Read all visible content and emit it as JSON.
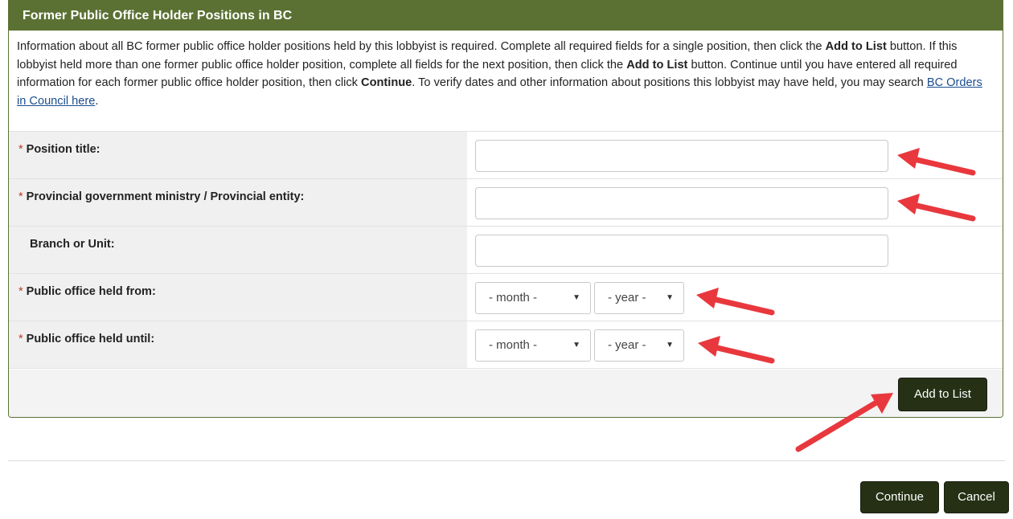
{
  "panel": {
    "title": "Former Public Office Holder Positions in BC",
    "intro": {
      "t1": "Information about all BC former public office holder positions held by this lobbyist is required. Complete all required fields for a single position, then click the ",
      "b1": "Add to List",
      "t2": " button. If this lobbyist held more than one former public office holder position, complete all fields for the next position, then click the ",
      "b2": "Add to List",
      "t3": " button. Continue until you have entered all required information for each former public office holder position, then click ",
      "b3": "Continue",
      "t4": ". To verify dates and other information about positions this lobbyist may have held, you may search ",
      "link": "BC Orders in Council here",
      "t5": "."
    }
  },
  "form": {
    "required_marker": "*",
    "position_title": {
      "label": "Position title:",
      "value": ""
    },
    "ministry": {
      "label": "Provincial government ministry / Provincial entity:",
      "value": ""
    },
    "branch": {
      "label": "Branch or Unit:",
      "value": ""
    },
    "held_from": {
      "label": "Public office held from:",
      "month": "- month -",
      "year": "- year -"
    },
    "held_until": {
      "label": "Public office held until:",
      "month": "- month -",
      "year": "- year -"
    },
    "caret": "▼"
  },
  "buttons": {
    "add_to_list": "Add to List",
    "continue": "Continue",
    "cancel": "Cancel"
  },
  "colors": {
    "header_green": "#5b7133",
    "button_dark": "#263015",
    "annotation_arrow": "#e8383d"
  }
}
